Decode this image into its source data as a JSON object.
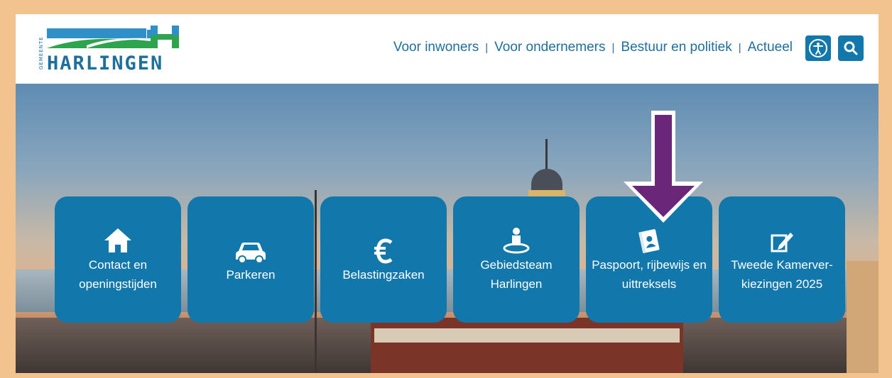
{
  "logo": {
    "sub_text": "GEMEENTE",
    "main_text": "HARLINGEN",
    "colors": {
      "blue": "#2f8fc6",
      "green": "#2ea44f",
      "text": "#1f6f9d"
    }
  },
  "nav": {
    "items": [
      {
        "label": "Voor inwoners"
      },
      {
        "label": "Voor ondernemers"
      },
      {
        "label": "Bestuur en politiek"
      },
      {
        "label": "Actueel"
      }
    ],
    "separator": "|"
  },
  "header_buttons": {
    "accessibility_icon": "accessibility-icon",
    "search_icon": "search-icon"
  },
  "tiles": [
    {
      "label": "Contact en openingstijden",
      "icon": "home-icon"
    },
    {
      "label": "Parkeren",
      "icon": "car-icon"
    },
    {
      "label": "Belastingzaken",
      "icon": "euro-icon"
    },
    {
      "label": "Gebiedsteam Harlingen",
      "icon": "person-location-icon"
    },
    {
      "label": "Paspoort, rijbewijs en uittreksels",
      "icon": "id-card-icon"
    },
    {
      "label": "Tweede Kamerver-kiezingen 2025",
      "icon": "pencil-icon"
    }
  ],
  "colors": {
    "accent": "#1277aa",
    "frame": "#f3c38f",
    "arrow": "#6a2678"
  }
}
